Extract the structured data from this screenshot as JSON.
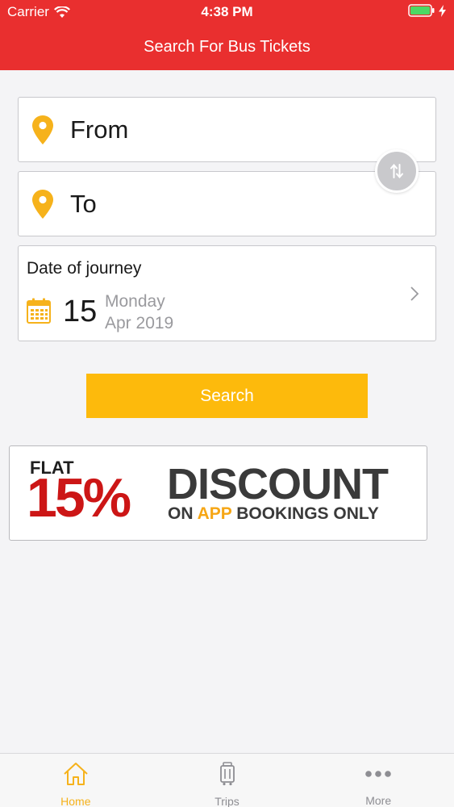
{
  "status_bar": {
    "carrier": "Carrier",
    "time": "4:38 PM"
  },
  "nav": {
    "title": "Search For Bus Tickets"
  },
  "from": {
    "label": "From"
  },
  "to": {
    "label": "To"
  },
  "date": {
    "title": "Date of journey",
    "day": "15",
    "weekday": "Monday",
    "month_year": "Apr 2019"
  },
  "search": {
    "label": "Search"
  },
  "promo": {
    "flat": "FLAT",
    "percent": "15%",
    "discount": "DISCOUNT",
    "tag_on": "ON ",
    "tag_app": "APP",
    "tag_rest": " BOOKINGS ONLY"
  },
  "tabs": [
    {
      "label": "Home",
      "icon": "home-icon"
    },
    {
      "label": "Trips",
      "icon": "trips-icon"
    },
    {
      "label": "More",
      "icon": "more-icon"
    }
  ],
  "colors": {
    "brand_red": "#e92f2f",
    "accent_yellow": "#fdba0c",
    "pin_yellow": "#f6b21b",
    "promo_red": "#cc1616"
  }
}
